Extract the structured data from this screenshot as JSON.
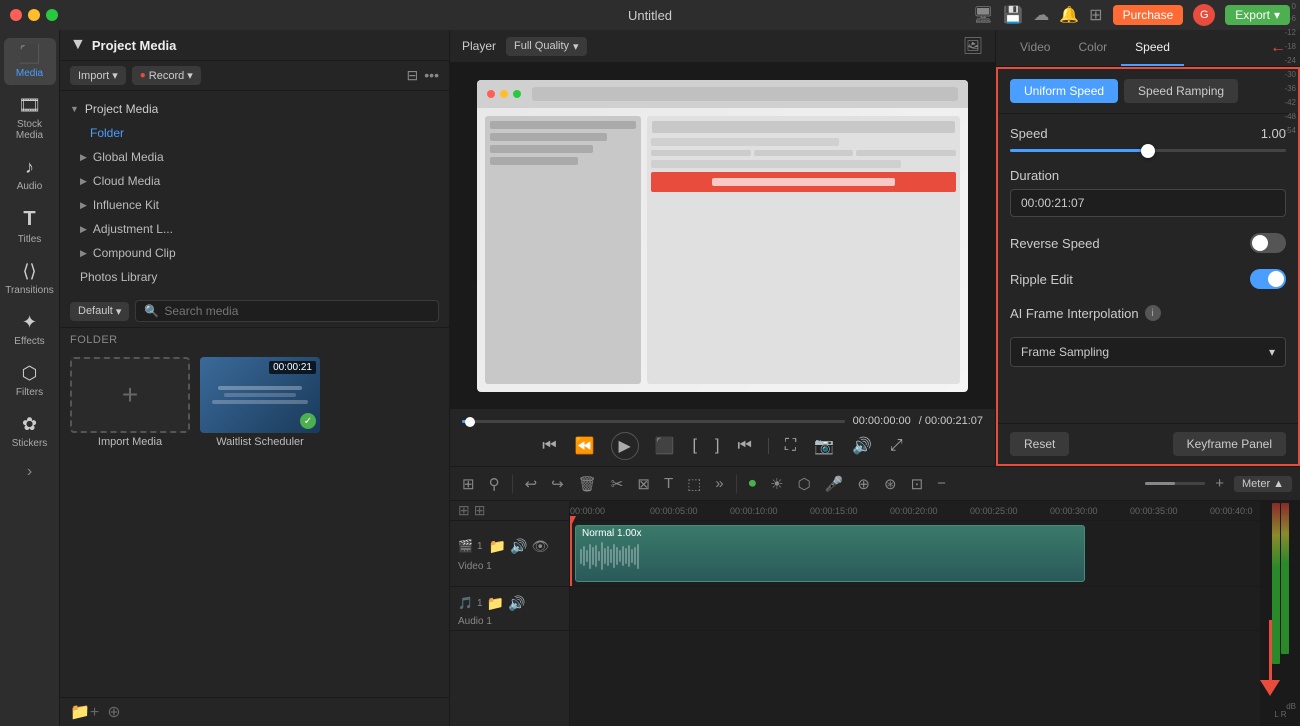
{
  "app": {
    "title": "Untitled",
    "purchase_label": "Purchase",
    "export_label": "Export",
    "avatar_label": "G"
  },
  "toolbar": {
    "items": [
      {
        "id": "media",
        "icon": "🎬",
        "label": "Media",
        "active": true
      },
      {
        "id": "stock-media",
        "icon": "🎞",
        "label": "Stock Media",
        "active": false
      },
      {
        "id": "audio",
        "icon": "🎵",
        "label": "Audio",
        "active": false
      },
      {
        "id": "titles",
        "icon": "T",
        "label": "Titles",
        "active": false
      },
      {
        "id": "transitions",
        "icon": "⟨⟩",
        "label": "Transitions",
        "active": false
      },
      {
        "id": "effects",
        "icon": "✨",
        "label": "Effects",
        "active": false
      },
      {
        "id": "filters",
        "icon": "🎨",
        "label": "Filters",
        "active": false
      },
      {
        "id": "stickers",
        "icon": "⭐",
        "label": "Stickers",
        "active": false
      }
    ]
  },
  "media_panel": {
    "title": "Project Media",
    "import_label": "Import",
    "record_label": "Record",
    "sort_label": "Default",
    "search_placeholder": "Search media",
    "folder_header": "FOLDER",
    "sidebar": [
      {
        "id": "project-media",
        "label": "Project Media",
        "icon": "▼"
      },
      {
        "id": "folder",
        "label": "Folder",
        "active": true
      },
      {
        "id": "global-media",
        "label": "Global Media"
      },
      {
        "id": "cloud-media",
        "label": "Cloud Media"
      },
      {
        "id": "influence-kit",
        "label": "Influence Kit"
      },
      {
        "id": "adjustment-l",
        "label": "Adjustment L..."
      },
      {
        "id": "compound-clip",
        "label": "Compound Clip"
      },
      {
        "id": "photos-library",
        "label": "Photos Library"
      }
    ],
    "media_items": [
      {
        "id": "import-media",
        "type": "import",
        "label": "Import Media"
      },
      {
        "id": "waitlist-scheduler",
        "type": "video",
        "label": "Waitlist Scheduler",
        "duration": "00:00:21",
        "has_check": true
      }
    ]
  },
  "player": {
    "label": "Player",
    "quality": "Full Quality",
    "current_time": "00:00:00:00",
    "total_time": "/ 00:00:21:07",
    "progress_percent": 2
  },
  "right_panel": {
    "tabs": [
      {
        "id": "video",
        "label": "Video",
        "active": false
      },
      {
        "id": "color",
        "label": "Color",
        "active": false
      },
      {
        "id": "speed",
        "label": "Speed",
        "active": true
      }
    ],
    "speed": {
      "uniform_speed_label": "Uniform Speed",
      "speed_ramping_label": "Speed Ramping",
      "speed_label": "Speed",
      "speed_value": "1.00",
      "speed_percent": 50,
      "duration_label": "Duration",
      "duration_value": "00:00:21:07",
      "reverse_speed_label": "Reverse Speed",
      "reverse_speed_on": false,
      "ripple_edit_label": "Ripple Edit",
      "ripple_edit_on": true,
      "ai_frame_label": "AI Frame Interpolation",
      "frame_sampling_label": "Frame Sampling",
      "reset_label": "Reset",
      "keyframe_label": "Keyframe Panel"
    }
  },
  "timeline": {
    "ruler_marks": [
      "00:00:00",
      "00:00:05:00",
      "00:00:10:00",
      "00:00:15:00",
      "00:00:20:00",
      "00:00:25:00",
      "00:00:30:00",
      "00:00:35:00",
      "00:00:40:0"
    ],
    "tracks": [
      {
        "id": "video-1",
        "type": "video",
        "label": "Video 1",
        "icons": [
          "📹",
          "📁",
          "🔊",
          "👁"
        ]
      },
      {
        "id": "audio-1",
        "type": "audio",
        "label": "Audio 1",
        "icons": [
          "🎵",
          "📁",
          "🔊"
        ]
      }
    ],
    "clip": {
      "label": "Normal 1.00x",
      "left_percent": 3,
      "width_percent": 30
    },
    "meter_label": "Meter",
    "level_labels": [
      "0",
      "-6",
      "-12",
      "-18",
      "-24",
      "-30",
      "-36",
      "-42",
      "-48",
      "-54",
      "dB"
    ],
    "lr_label": "L  R"
  }
}
